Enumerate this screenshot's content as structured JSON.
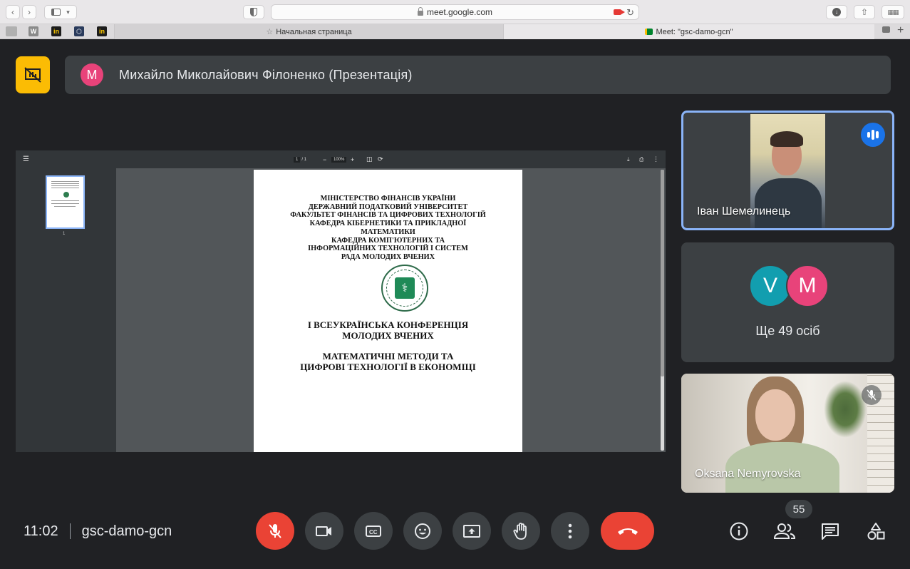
{
  "browser": {
    "url": "meet.google.com",
    "tabs": [
      {
        "label": "Начальная страница",
        "active": false
      },
      {
        "label": "Meet: \"gsc-damo-gcn\"",
        "active": true
      }
    ],
    "favicons": [
      "W",
      "in",
      "in"
    ]
  },
  "presenter": {
    "avatar_letter": "M",
    "name": "Михайло Миколайович Філоненко (Презентація)",
    "avatar_color": "#e8437a"
  },
  "pdf": {
    "page_current": "1",
    "page_total": "/ 1",
    "zoom": "100%",
    "thumb_label": "1",
    "org_lines": [
      "МІНІСТЕРСТВО ФІНАНСІВ УКРАЇНИ",
      "ДЕРЖАВНИЙ ПОДАТКОВИЙ УНІВЕРСИТЕТ",
      "ФАКУЛЬТЕТ ФІНАНСІВ ТА ЦИФРОВИХ ТЕХНОЛОГІЙ",
      "КАФЕДРА КІБЕРНЕТИКИ ТА ПРИКЛАДНОЇ",
      "МАТЕМАТИКИ",
      "КАФЕДРА КОМП'ЮТЕРНИХ ТА",
      "ІНФОРМАЦІЙНИХ ТЕХНОЛОГІЙ І СИСТЕМ",
      "РАДА МОЛОДИХ ВЧЕНИХ"
    ],
    "conference_lines": [
      "I ВСЕУКРАЇНСЬКА КОНФЕРЕНЦІЯ",
      "МОЛОДИХ ВЧЕНИХ"
    ],
    "topic_lines": [
      "МАТЕМАТИЧНІ МЕТОДИ ТА",
      "ЦИФРОВІ ТЕХНОЛОГІЇ В ЕКОНОМІЦІ"
    ]
  },
  "participants": {
    "speaker_name": "Іван Шемелинець",
    "others_letters": [
      "V",
      "M"
    ],
    "others_label": "Ще 49 осіб",
    "self_name": "Oksana Nemyrovska"
  },
  "meeting": {
    "time": "11:02",
    "code": "gsc-damo-gcn",
    "participant_count": "55"
  },
  "colors": {
    "accent": "#1a73e8",
    "end_call": "#ea4335",
    "present_badge": "#fbbc04"
  }
}
